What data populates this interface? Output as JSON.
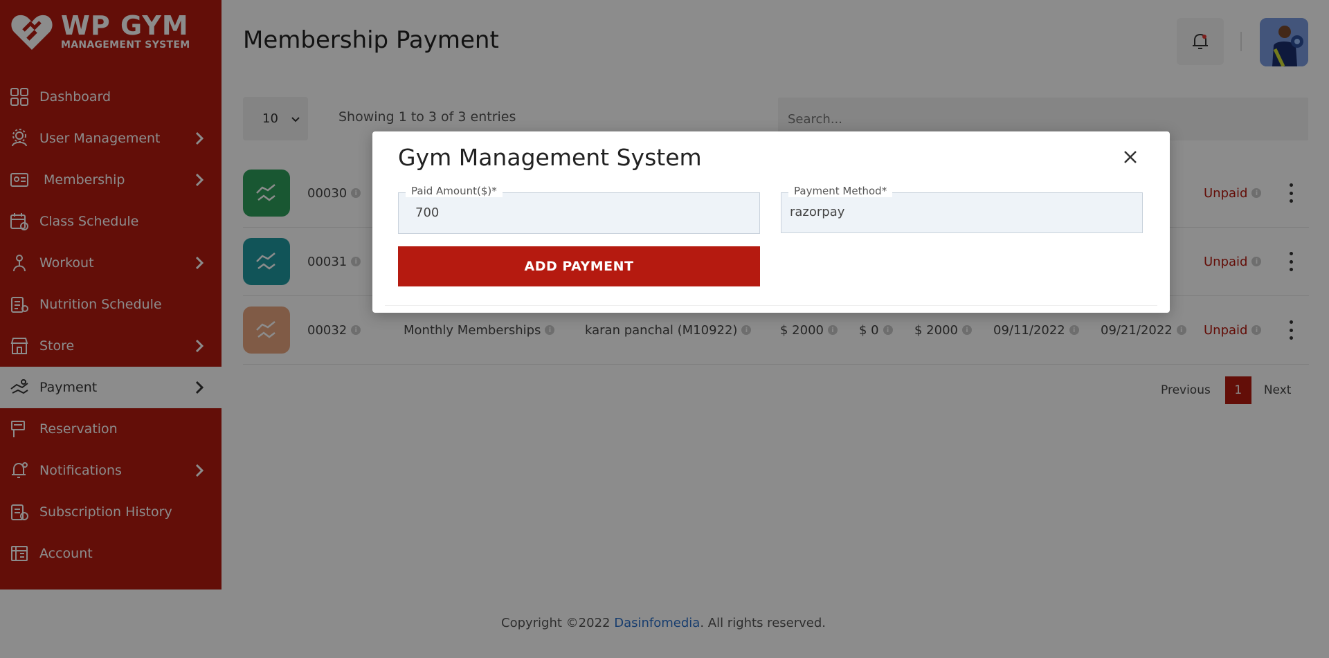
{
  "brand": {
    "title": "WP GYM",
    "subtitle": "MANAGEMENT SYSTEM"
  },
  "sidebar": {
    "items": [
      {
        "label": "Dashboard",
        "icon": "dashboard-icon",
        "chevron": false
      },
      {
        "label": "User Management",
        "icon": "users-gear-icon",
        "chevron": true
      },
      {
        "label": "Membership",
        "icon": "membership-card-icon",
        "chevron": true
      },
      {
        "label": "Class Schedule",
        "icon": "calendar-icon",
        "chevron": false
      },
      {
        "label": "Workout",
        "icon": "workout-icon",
        "chevron": true
      },
      {
        "label": "Nutrition Schedule",
        "icon": "nutrition-icon",
        "chevron": false
      },
      {
        "label": "Store",
        "icon": "store-icon",
        "chevron": true
      },
      {
        "label": "Payment",
        "icon": "payment-icon",
        "chevron": true,
        "active": true
      },
      {
        "label": "Reservation",
        "icon": "reservation-icon",
        "chevron": false
      },
      {
        "label": "Notifications",
        "icon": "bell-icon",
        "chevron": true
      },
      {
        "label": "Subscription History",
        "icon": "subscription-icon",
        "chevron": false
      },
      {
        "label": "Account",
        "icon": "account-icon",
        "chevron": false
      }
    ]
  },
  "header": {
    "title": "Membership Payment"
  },
  "table_controls": {
    "page_length": "10",
    "showing": "Showing 1 to 3 of 3 entries",
    "search_placeholder": "Search..."
  },
  "rows": [
    {
      "id": "00030",
      "membership": "",
      "member": "",
      "amount": "",
      "paid": "",
      "due": "",
      "start": "",
      "end": "",
      "status": "Unpaid",
      "color": "#2e9e5b"
    },
    {
      "id": "00031",
      "membership": "",
      "member": "",
      "amount": "",
      "paid": "",
      "due": "",
      "start": "",
      "end": "",
      "status": "Unpaid",
      "color": "#1f9aa0"
    },
    {
      "id": "00032",
      "membership": "Monthly Memberships",
      "member": "karan panchal (M10922)",
      "amount": "$ 2000",
      "paid": "$ 0",
      "due": "$ 2000",
      "start": "09/11/2022",
      "end": "09/21/2022",
      "status": "Unpaid",
      "color": "#e9a680"
    }
  ],
  "pagination": {
    "previous": "Previous",
    "current": "1",
    "next": "Next"
  },
  "footer": {
    "prefix": "Copyright ©2022 ",
    "company": "Dasinfomedia",
    "suffix": ". All rights reserved."
  },
  "modal": {
    "title": "Gym Management System",
    "paid_amount_label": "Paid Amount($)*",
    "paid_amount_value": "700",
    "payment_method_label": "Payment Method*",
    "payment_method_value": "razorpay",
    "submit_label": "ADD PAYMENT"
  },
  "colors": {
    "brand_red": "#b51a10",
    "link_blue": "#2a6fc9"
  }
}
